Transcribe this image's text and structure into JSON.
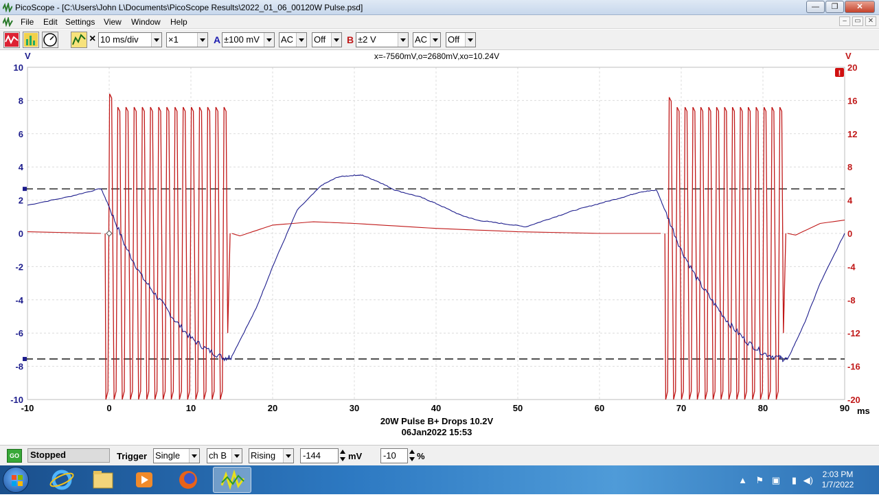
{
  "window": {
    "title": "PicoScope - [C:\\Users\\John L\\Documents\\PicoScope Results\\2022_01_06_00120W Pulse.psd]",
    "minimize": "—",
    "maximize": "❐",
    "close": "✕"
  },
  "menu": [
    "File",
    "Edit",
    "Settings",
    "View",
    "Window",
    "Help"
  ],
  "mdi_controls": [
    "–",
    "▭",
    "✕"
  ],
  "toolbar": {
    "timebase": "10 ms/div",
    "zoom": "×1",
    "channel_a": {
      "label": "A",
      "range": "±100 mV",
      "coupling": "AC",
      "filter": "Off",
      "color": "#1c1cb0"
    },
    "channel_b": {
      "label": "B",
      "range": "±2 V",
      "coupling": "AC",
      "filter": "Off",
      "color": "#c01818"
    },
    "multiply_sign": "×"
  },
  "scope": {
    "measurement": "x=-7560mV,o=2680mV,xo=10.24V",
    "left_unit": "V",
    "right_unit": "V",
    "x_unit": "ms",
    "caption": "20W Pulse B+ Drops 10.2V",
    "datetime": "06Jan2022  15:53",
    "warning_icon": "!"
  },
  "chart_data": {
    "type": "line",
    "xlabel": "ms",
    "xlim": [
      -10,
      90
    ],
    "x_ticks": [
      "-10",
      "0",
      "10",
      "20",
      "30",
      "40",
      "50",
      "60",
      "70",
      "80",
      "90"
    ],
    "y_left": {
      "unit": "V",
      "lim": [
        -10,
        10
      ],
      "ticks": [
        "10",
        "8",
        "6",
        "4",
        "2",
        "0",
        "-2",
        "-4",
        "-6",
        "-8",
        "-10"
      ],
      "color": "#1c1c8c"
    },
    "y_right": {
      "unit": "V",
      "lim": [
        -20,
        20
      ],
      "ticks": [
        "20",
        "16",
        "12",
        "8",
        "4",
        "0",
        "-4",
        "-8",
        "-12",
        "-16",
        "-20"
      ],
      "color": "#c01818"
    },
    "rulers": {
      "upper": 2.68,
      "lower": -7.56,
      "axis": "left"
    },
    "grid": true,
    "series": [
      {
        "channel": "A",
        "color": "#1c1c8c",
        "axis": "left",
        "x": [
          -10,
          -5,
          -1,
          0,
          2,
          4,
          6,
          8,
          10,
          12,
          14,
          15,
          18,
          20,
          23,
          26,
          28,
          30,
          31,
          33,
          35,
          38,
          40,
          43,
          45,
          48,
          51,
          54,
          57,
          60,
          63,
          65,
          67,
          68,
          70,
          72,
          74,
          76,
          78,
          80,
          82,
          83,
          85,
          87,
          90
        ],
        "y": [
          1.7,
          2.2,
          2.7,
          1.6,
          -0.8,
          -2.6,
          -3.9,
          -5.2,
          -6.3,
          -7.0,
          -7.5,
          -7.4,
          -4.5,
          -2.0,
          1.4,
          2.9,
          3.4,
          3.5,
          3.5,
          3.1,
          2.6,
          2.2,
          1.8,
          1.1,
          0.8,
          0.6,
          0.4,
          0.9,
          1.4,
          1.8,
          2.2,
          2.5,
          2.6,
          1.4,
          -1.0,
          -2.8,
          -4.2,
          -5.5,
          -6.5,
          -7.2,
          -7.5,
          -7.6,
          -5.5,
          -3.0,
          0.0
        ]
      },
      {
        "channel": "B",
        "color": "#c01818",
        "axis": "right",
        "x": [
          -10,
          -1,
          15,
          16,
          20,
          25,
          30,
          40,
          50,
          60,
          67.5,
          83,
          84,
          87,
          90
        ],
        "y": [
          0.2,
          0.0,
          0.0,
          -0.3,
          1.0,
          1.4,
          1.2,
          0.6,
          0.2,
          0.0,
          0.0,
          0.0,
          -0.2,
          1.2,
          1.6
        ],
        "bursts": [
          {
            "start_ms": -0.5,
            "end_ms": 14.5,
            "cycles": 15,
            "peak_v": 15.2,
            "first_peak_v": 16.8,
            "trough_v": -20
          },
          {
            "start_ms": 68,
            "end_ms": 82.5,
            "cycles": 15,
            "peak_v": 15.2,
            "first_peak_v": 16.4,
            "trough_v": -20
          }
        ]
      }
    ]
  },
  "statusbar": {
    "go_label": "GO",
    "state": "Stopped",
    "trigger_label": "Trigger",
    "trigger_mode": "Single",
    "trigger_source": "ch B",
    "trigger_edge": "Rising",
    "threshold": "-144",
    "threshold_unit": "mV",
    "pretrigger": "-10",
    "pretrigger_unit": "%"
  },
  "taskbar": {
    "time": "2:03 PM",
    "date": "1/7/2022"
  }
}
